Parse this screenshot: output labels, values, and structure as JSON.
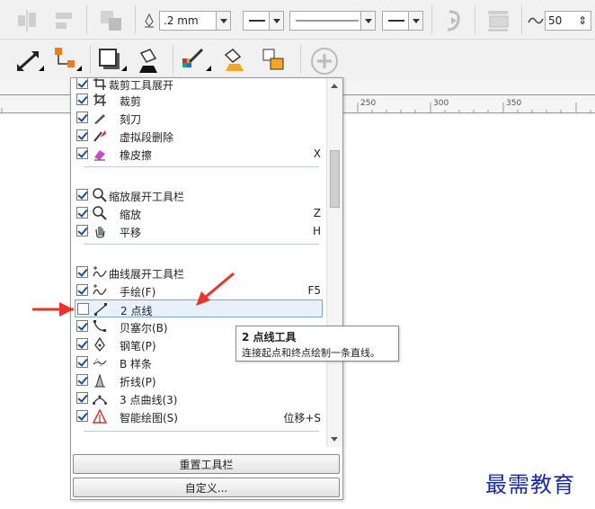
{
  "toolbar": {
    "outline_width": ".2 mm",
    "miter_value": "50",
    "icons_row1": [
      "align-icon",
      "distribute-icon",
      "transform-icon",
      "pen-width-icon",
      "start-arrow-icon",
      "line-style-icon",
      "end-arrow-icon",
      "wrap-text-icon",
      "order-icon",
      "miter-icon"
    ],
    "icons_row2": [
      "dimension-icon",
      "connector-icon",
      "drop-shadow-icon",
      "fill-icon",
      "color-eyedropper-icon",
      "attribute-eyedropper-icon",
      "smart-fill-icon",
      "add-icon"
    ]
  },
  "ruler": {
    "labels": [
      "250",
      "300",
      "350"
    ]
  },
  "panel": {
    "items": [
      {
        "label": "裁剪工具展开",
        "checked": true,
        "icon": "crop-flyout-icon",
        "shortcut": "",
        "indent": false
      },
      {
        "label": "裁剪",
        "checked": true,
        "icon": "crop-icon",
        "shortcut": "",
        "indent": true
      },
      {
        "label": "刻刀",
        "checked": true,
        "icon": "knife-icon",
        "shortcut": "",
        "indent": true
      },
      {
        "label": "虚拟段删除",
        "checked": true,
        "icon": "virtual-segment-delete-icon",
        "shortcut": "",
        "indent": true
      },
      {
        "label": "橡皮擦",
        "checked": true,
        "icon": "eraser-icon",
        "shortcut": "X",
        "indent": true
      },
      {
        "label": "缩放展开工具栏",
        "checked": true,
        "icon": "zoom-icon",
        "shortcut": "",
        "indent": false
      },
      {
        "label": "缩放",
        "checked": true,
        "icon": "zoom-icon",
        "shortcut": "Z",
        "indent": true
      },
      {
        "label": "平移",
        "checked": true,
        "icon": "pan-hand-icon",
        "shortcut": "H",
        "indent": true
      },
      {
        "label": "曲线展开工具栏",
        "checked": true,
        "icon": "curve-flyout-icon",
        "shortcut": "",
        "indent": false
      },
      {
        "label": "手绘(F)",
        "checked": true,
        "icon": "freehand-icon",
        "shortcut": "F5",
        "indent": true
      },
      {
        "label": "2 点线",
        "checked": false,
        "icon": "two-point-line-icon",
        "shortcut": "",
        "indent": true
      },
      {
        "label": "贝塞尔(B)",
        "checked": true,
        "icon": "bezier-icon",
        "shortcut": "",
        "indent": true
      },
      {
        "label": "钢笔(P)",
        "checked": true,
        "icon": "pen-icon",
        "shortcut": "",
        "indent": true
      },
      {
        "label": "B 样条",
        "checked": true,
        "icon": "b-spline-icon",
        "shortcut": "",
        "indent": true
      },
      {
        "label": "折线(P)",
        "checked": true,
        "icon": "polyline-icon",
        "shortcut": "",
        "indent": true
      },
      {
        "label": "3 点曲线(3)",
        "checked": true,
        "icon": "three-point-curve-icon",
        "shortcut": "",
        "indent": true
      },
      {
        "label": "智能绘图(S)",
        "checked": true,
        "icon": "smart-drawing-icon",
        "shortcut": "位移+S",
        "indent": true
      }
    ],
    "reset_button": "重置工具栏",
    "customize_button": "自定义..."
  },
  "tooltip": {
    "title": "2 点线工具",
    "description": "连接起点和终点绘制一条直线。"
  },
  "watermark": "最需教育",
  "colors": {
    "accent": "#36b0c4",
    "arrow": "#e8332a",
    "watermark": "#1a2c9c"
  }
}
